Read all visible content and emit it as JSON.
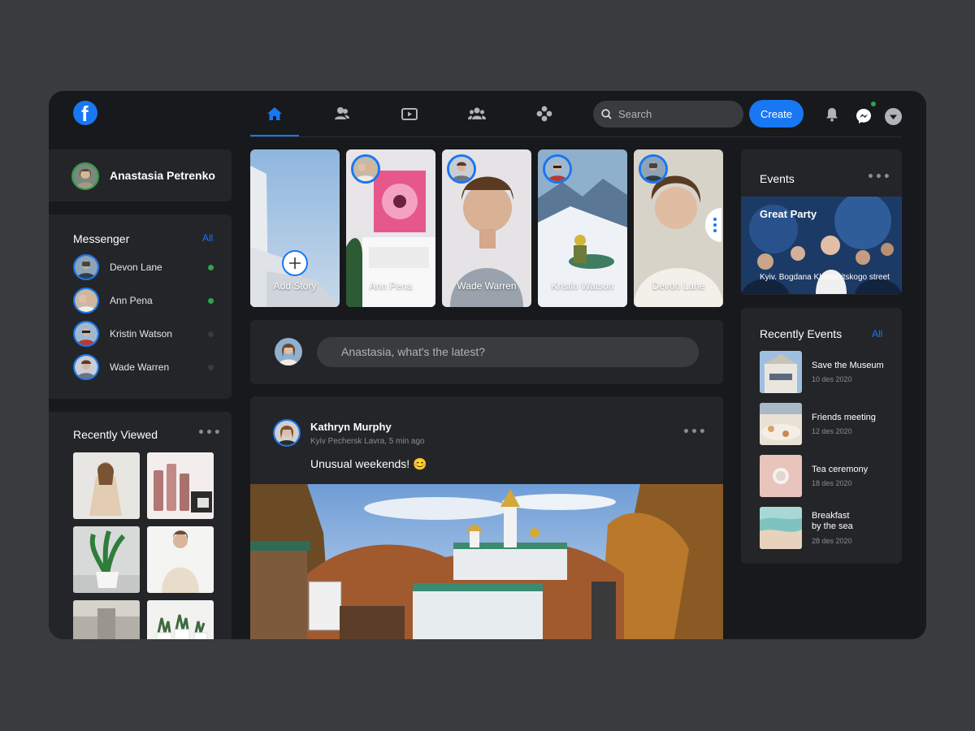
{
  "topbar": {
    "logo_letter": "f",
    "logo_icon": "facebook-logo-icon",
    "nav": [
      {
        "name": "home",
        "icon": "home-icon",
        "active": true
      },
      {
        "name": "friends",
        "icon": "friends-icon",
        "active": false
      },
      {
        "name": "watch",
        "icon": "video-icon",
        "active": false
      },
      {
        "name": "groups",
        "icon": "groups-icon",
        "active": false
      },
      {
        "name": "gaming",
        "icon": "gamepad-icon",
        "active": false
      }
    ],
    "search_placeholder": "Search",
    "create_label": "Create",
    "accent": "#1877f2"
  },
  "profile": {
    "name": "Anastasia Petrenko"
  },
  "messenger": {
    "title": "Messenger",
    "all_label": "All",
    "contacts": [
      {
        "name": "Devon Lane",
        "online": true
      },
      {
        "name": "Ann Pena",
        "online": true
      },
      {
        "name": "Kristin Watson",
        "online": false
      },
      {
        "name": "Wade Warren",
        "online": false
      }
    ]
  },
  "recently_viewed": {
    "title": "Recently Viewed"
  },
  "stories": [
    {
      "label": "Add Story"
    },
    {
      "label": "Ann Pena"
    },
    {
      "label": "Wade Warren"
    },
    {
      "label": "Kristin Watson"
    },
    {
      "label": "Devon Lane"
    }
  ],
  "composer": {
    "placeholder": "Anastasia, what's the latest?"
  },
  "post": {
    "author": "Kathryn Murphy",
    "meta": "Kyiv Pechersk Lavra, 5 min ago",
    "text": "Unusual weekends! 😊"
  },
  "events": {
    "title": "Events",
    "featured": {
      "title": "Great Party",
      "place": "Kyiv. Bogdana Khmelnitskogo street"
    }
  },
  "recent_events": {
    "title": "Recently Events",
    "all_label": "All",
    "items": [
      {
        "name": "Save the Museum",
        "date": "10 des 2020"
      },
      {
        "name": "Friends meeting",
        "date": "12 des 2020"
      },
      {
        "name": "Tea ceremony",
        "date": "18 des 2020"
      },
      {
        "name": "Breakfast\nby the sea",
        "date": "28 des 2020"
      }
    ]
  }
}
